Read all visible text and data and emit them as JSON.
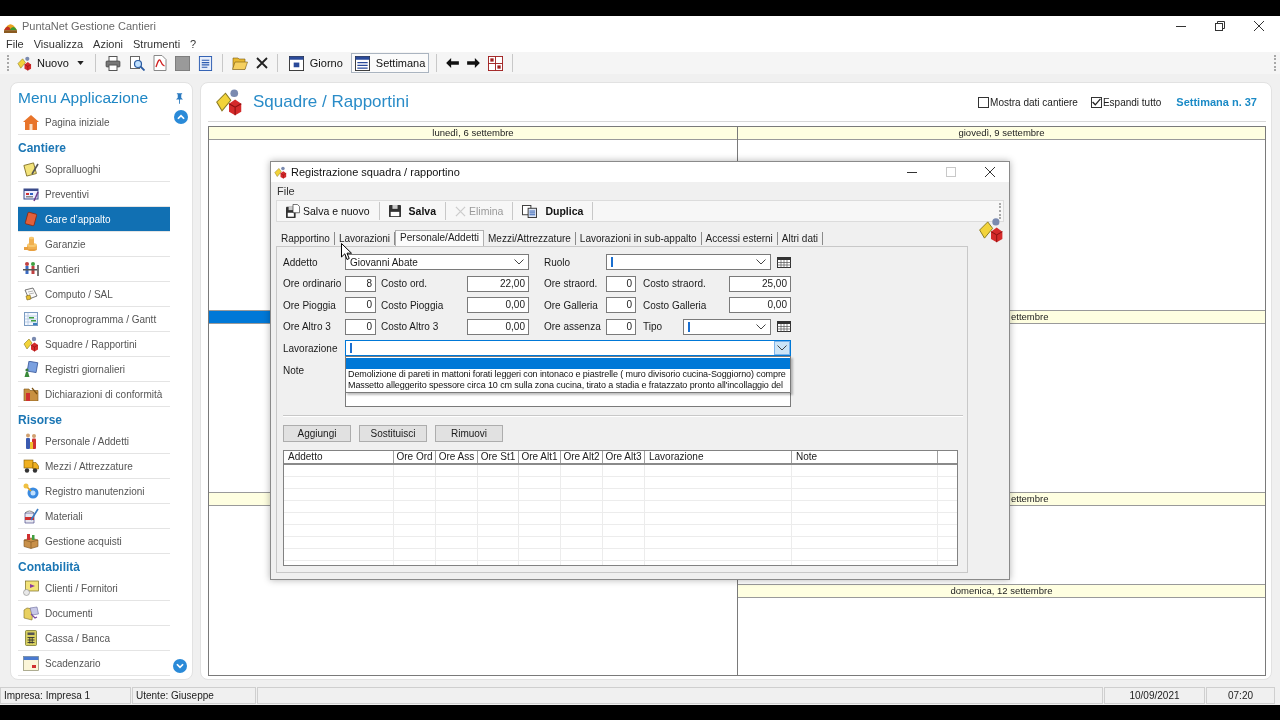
{
  "app": {
    "title": "PuntaNet Gestione Cantieri"
  },
  "menu": [
    "File",
    "Visualizza",
    "Azioni",
    "Strumenti",
    "?"
  ],
  "toolbar": {
    "new_label": "Nuovo",
    "views": [
      {
        "label": "Giorno",
        "selected": false
      },
      {
        "label": "Settimana",
        "selected": true
      }
    ]
  },
  "sidebar": {
    "title": "Menu Applicazione",
    "home": {
      "label": "Pagina iniziale",
      "selected": false
    },
    "sections": [
      {
        "title": "Cantiere",
        "items": [
          {
            "label": "Sopralluoghi",
            "selected": false
          },
          {
            "label": "Preventivi",
            "selected": false
          },
          {
            "label": "Gare d’appalto",
            "selected": true
          },
          {
            "label": "Garanzie",
            "selected": false
          },
          {
            "label": "Cantieri",
            "selected": false
          },
          {
            "label": "Computo / SAL",
            "selected": false
          },
          {
            "label": "Cronoprogramma / Gantt",
            "selected": false
          },
          {
            "label": "Squadre / Rapportini",
            "selected": false
          },
          {
            "label": "Registri giornalieri",
            "selected": false
          },
          {
            "label": "Dichiarazioni di conformità",
            "selected": false
          }
        ]
      },
      {
        "title": "Risorse",
        "items": [
          {
            "label": "Personale / Addetti",
            "selected": false
          },
          {
            "label": "Mezzi / Attrezzature",
            "selected": false
          },
          {
            "label": "Registro manutenzioni",
            "selected": false
          },
          {
            "label": "Materiali",
            "selected": false
          },
          {
            "label": "Gestione acquisti",
            "selected": false
          }
        ]
      },
      {
        "title": "Contabilità",
        "items": [
          {
            "label": "Clienti / Fornitori",
            "selected": false
          },
          {
            "label": "Documenti",
            "selected": false
          },
          {
            "label": "Cassa / Banca",
            "selected": false
          },
          {
            "label": "Scadenzario",
            "selected": false
          }
        ]
      }
    ]
  },
  "main": {
    "title": "Squadre / Rapportini",
    "options": [
      {
        "label": "Mostra dati cantiere",
        "checked": false
      },
      {
        "label": "Espandi tutto",
        "checked": true
      }
    ],
    "week": "Settimana n. 37"
  },
  "calendar": {
    "columns": [
      {
        "days": [
          {
            "header": "lunedì, 6 settembre",
            "selected": false,
            "clipped": false
          },
          {
            "selected": true
          },
          {
            "selected": false
          }
        ]
      },
      {
        "days": [
          {
            "header": "giovedì, 9 settembre",
            "selected": false,
            "clipped": false
          },
          {
            "header": "ettembre",
            "selected": false,
            "clipped": true
          },
          {
            "header": "ettembre",
            "selected": false,
            "clipped": true
          },
          {
            "header": "domenica, 12 settembre",
            "selected": false,
            "clipped": false
          }
        ]
      }
    ]
  },
  "dialog": {
    "title": "Registrazione squadra / rapportino",
    "menu": [
      "File"
    ],
    "toolbar": [
      {
        "label": "Salva e nuovo",
        "disabled": false
      },
      {
        "label": "Salva",
        "disabled": false
      },
      {
        "label": "Elimina",
        "disabled": true
      },
      {
        "label": "Duplica",
        "disabled": false
      }
    ],
    "tabs": [
      {
        "label": "Rapportino",
        "selected": false
      },
      {
        "label": "Lavorazioni",
        "selected": false
      },
      {
        "label": "Personale/Addetti",
        "selected": true
      },
      {
        "label": "Mezzi/Attrezzature",
        "selected": false
      },
      {
        "label": "Lavorazioni in sub-appalto",
        "selected": false
      },
      {
        "label": "Accessi esterni",
        "selected": false
      },
      {
        "label": "Altri dati",
        "selected": false
      }
    ],
    "form": {
      "rows": [
        [
          {
            "kind": "combo",
            "label": "Addetto",
            "value": "Giovanni Abate",
            "picker": false,
            "focused": false,
            "expanded": false
          },
          "",
          {
            "kind": "combo",
            "label": "Ruolo",
            "picker": true,
            "focused": false,
            "expanded": false
          }
        ],
        [
          {
            "kind": "number",
            "label": "Ore ordinario",
            "value": "8",
            "focused": false
          },
          {
            "kind": "number",
            "label": "Costo ord.",
            "value": "22,00",
            "focused": false
          },
          {
            "kind": "number",
            "label": "Ore straord.",
            "value": "0",
            "focused": false
          },
          {
            "kind": "number",
            "label": "Costo straord.",
            "value": "25,00",
            "focused": false
          }
        ],
        [
          {
            "kind": "number",
            "label": "Ore Pioggia",
            "value": "0",
            "focused": false
          },
          {
            "kind": "number",
            "label": "Costo Pioggia",
            "value": "0,00",
            "focused": false
          },
          {
            "kind": "number",
            "label": "Ore Galleria",
            "value": "0",
            "focused": false
          },
          {
            "kind": "number",
            "label": "Costo Galleria",
            "value": "0,00",
            "focused": false
          }
        ],
        [
          {
            "kind": "number",
            "label": "Ore Altro 3",
            "value": "0",
            "focused": false
          },
          {
            "kind": "number",
            "label": "Costo Altro 3",
            "value": "0,00",
            "focused": false
          },
          {
            "kind": "number",
            "label": "Ore assenza",
            "value": "0",
            "focused": false
          },
          {
            "kind": "combo",
            "label": "Tipo",
            "picker": true,
            "focused": false,
            "expanded": false
          }
        ],
        [
          {
            "kind": "combo",
            "label": "Lavorazione",
            "picker": false,
            "focused": true,
            "expanded": true,
            "options": [
              {
                "selected": true
              },
              {
                "label": "Demolizione di pareti in mattoni forati leggeri con intonaco e piastrelle ( muro divisorio cucina-Soggiorno) compre",
                "selected": false
              },
              {
                "label": "Massetto alleggerito spessore circa 10 cm sulla zona cucina, tirato a stadia e fratazzato pronto all'incollaggio del",
                "selected": false
              }
            ]
          }
        ],
        [
          {
            "kind": "memo",
            "label": "Note",
            "focused": false
          }
        ]
      ]
    },
    "buttons": [
      "Aggiungi",
      "Sostituisci",
      "Rimuovi"
    ],
    "grid": {
      "columns": [
        "Addetto",
        "Ore Ord",
        "Ore Ass",
        "Ore St1",
        "Ore Alt1",
        "Ore Alt2",
        "Ore Alt3",
        "Lavorazione",
        "Note"
      ]
    }
  },
  "status_bar": [
    {
      "kind": "text",
      "text": "Impresa: Impresa 1"
    },
    {
      "kind": "text",
      "text": "Utente: Giuseppe"
    },
    {
      "kind": "spacer"
    },
    {
      "kind": "text",
      "text": "10/09/2021"
    },
    {
      "kind": "text",
      "text": "07:20"
    }
  ]
}
